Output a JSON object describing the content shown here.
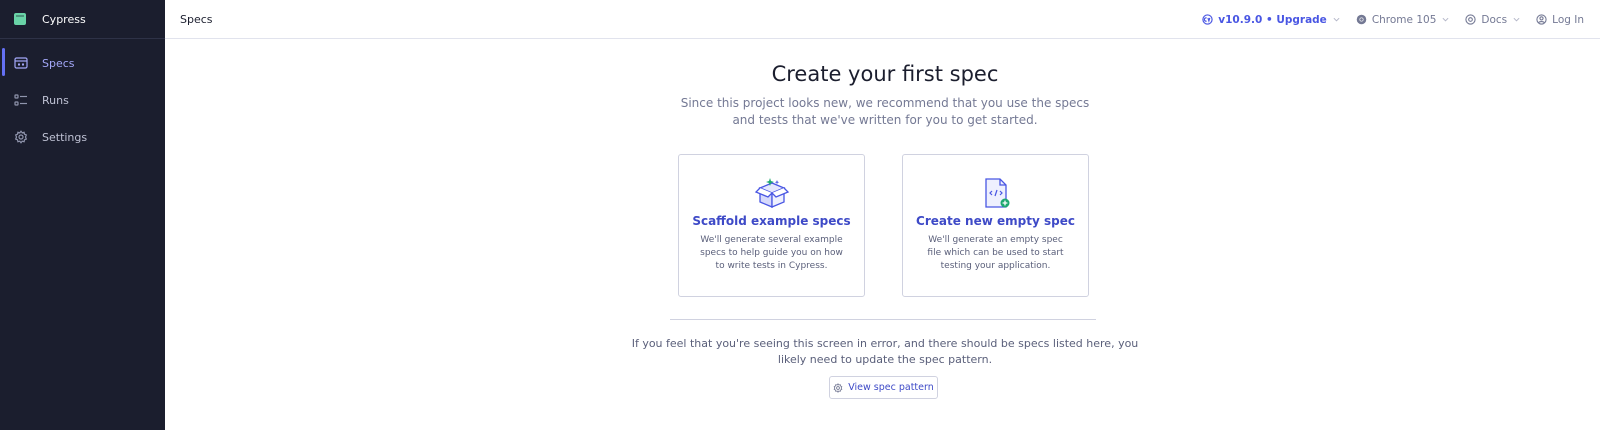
{
  "app": {
    "name": "Cypress"
  },
  "sidebar": {
    "items": [
      {
        "label": "Specs",
        "icon": "specs-icon",
        "active": true
      },
      {
        "label": "Runs",
        "icon": "runs-icon",
        "active": false
      },
      {
        "label": "Settings",
        "icon": "gear-icon",
        "active": false
      }
    ]
  },
  "header": {
    "title": "Specs",
    "version": "v10.9.0 • Upgrade",
    "browser": "Chrome 105",
    "docs": "Docs",
    "login": "Log In"
  },
  "main": {
    "title": "Create your first spec",
    "subtitle": "Since this project looks new, we recommend that you use the specs and tests that we've written for you to get started.",
    "cards": [
      {
        "title": "Scaffold example specs",
        "description": "We'll generate several example specs to help guide you on how to write tests in Cypress.",
        "icon": "box-icon"
      },
      {
        "title": "Create new empty spec",
        "description": "We'll generate an empty spec file which can be used to start testing your application.",
        "icon": "new-file-icon"
      }
    ],
    "error_text": "If you feel that you're seeing this screen in error, and there should be specs listed here, you likely need to update the spec pattern.",
    "view_spec_pattern": "View spec pattern"
  },
  "colors": {
    "sidebar_bg": "#1b1e2e",
    "accent": "#6470f3",
    "link": "#3e4ac7",
    "brand_green": "#69d3a7"
  }
}
